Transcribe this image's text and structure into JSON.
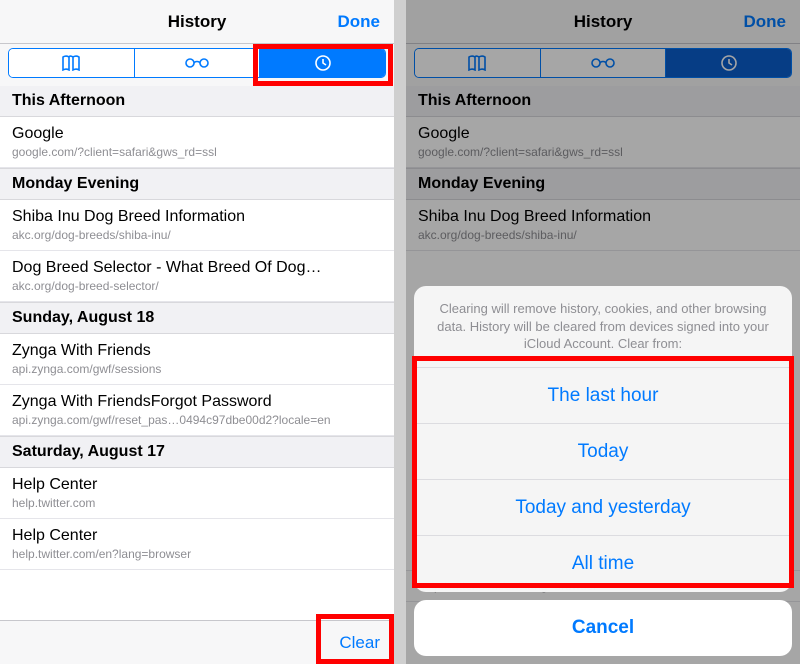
{
  "colors": {
    "accent": "#007aff",
    "highlight": "#ff0000"
  },
  "nav": {
    "title": "History",
    "done": "Done"
  },
  "tabs": {
    "bookmarks": "bookmarks-icon",
    "reading": "glasses-icon",
    "history": "clock-icon"
  },
  "sections": [
    {
      "header": "This Afternoon",
      "items": [
        {
          "title": "Google",
          "url": "google.com/?client=safari&gws_rd=ssl"
        }
      ]
    },
    {
      "header": "Monday Evening",
      "items": [
        {
          "title": "Shiba Inu Dog Breed Information",
          "url": "akc.org/dog-breeds/shiba-inu/"
        },
        {
          "title": "Dog Breed Selector - What Breed Of Dog…",
          "url": "akc.org/dog-breed-selector/"
        }
      ]
    },
    {
      "header": "Sunday, August 18",
      "items": [
        {
          "title": "Zynga With Friends",
          "url": "api.zynga.com/gwf/sessions"
        },
        {
          "title": "Zynga With FriendsForgot Password",
          "url": "api.zynga.com/gwf/reset_pas…0494c97dbe00d2?locale=en"
        }
      ]
    },
    {
      "header": "Saturday, August 17",
      "items": [
        {
          "title": "Help Center",
          "url": "help.twitter.com"
        },
        {
          "title": "Help Center",
          "url": "help.twitter.com/en?lang=browser"
        }
      ]
    }
  ],
  "toolbar": {
    "clear": "Clear"
  },
  "sheet": {
    "message": "Clearing will remove history, cookies, and other browsing data. History will be cleared from devices signed into your iCloud Account. Clear from:",
    "options": [
      "The last hour",
      "Today",
      "Today and yesterday",
      "All time"
    ],
    "cancel": "Cancel"
  },
  "right_peek_row": {
    "title": "Help Center",
    "url": "help.twitter.com/en?lang=browser"
  }
}
